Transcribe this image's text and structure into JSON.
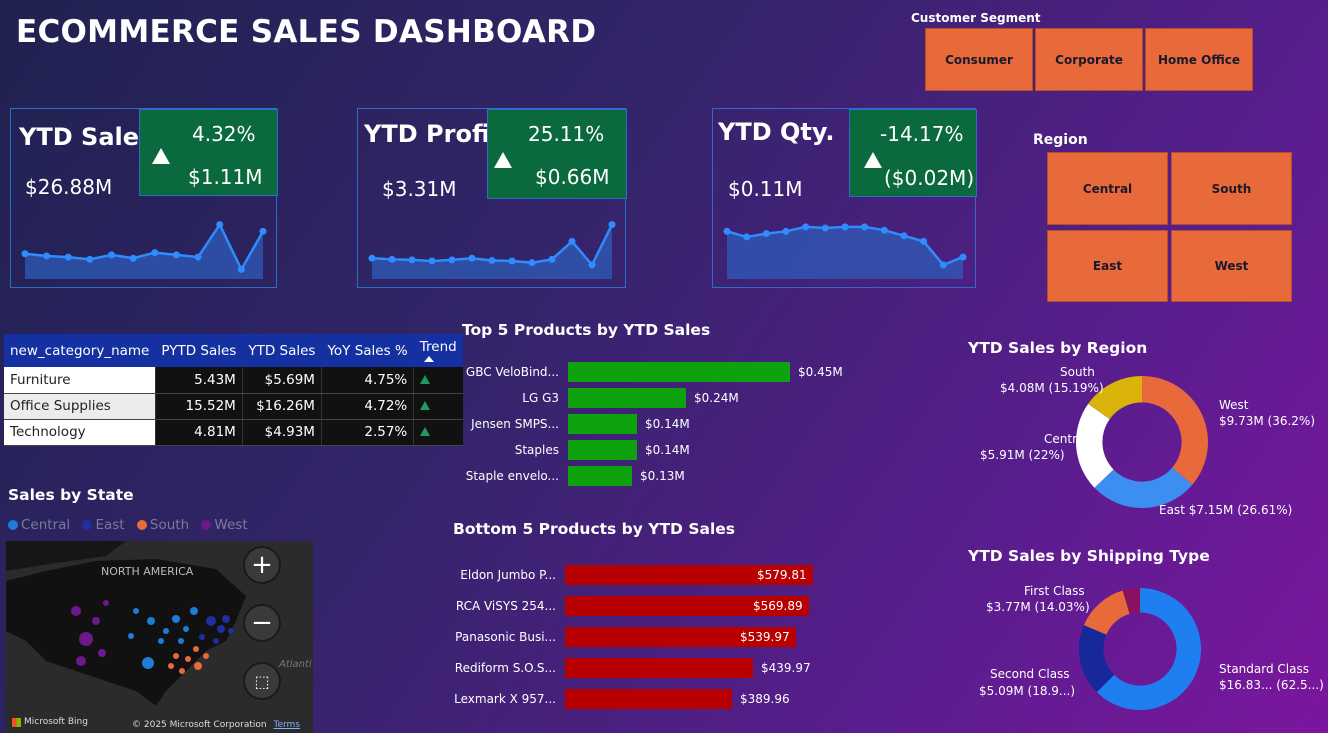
{
  "title": "ECOMMERCE SALES DASHBOARD",
  "customer_segment": {
    "label": "Customer Segment",
    "options": [
      "Consumer",
      "Corporate",
      "Home Office"
    ]
  },
  "region_slicer": {
    "label": "Region",
    "options": [
      "Central",
      "South",
      "East",
      "West"
    ]
  },
  "kpis": [
    {
      "title": "YTD Sales",
      "value": "$26.88M",
      "pct": "4.32%",
      "delta": "$1.11M",
      "trend": [
        0.38,
        0.34,
        0.32,
        0.28,
        0.36,
        0.3,
        0.4,
        0.36,
        0.32,
        0.9,
        0.1,
        0.78
      ]
    },
    {
      "title": "YTD Profit",
      "value": "$3.31M",
      "pct": "25.11%",
      "delta": "$0.66M",
      "trend": [
        0.3,
        0.28,
        0.27,
        0.25,
        0.27,
        0.3,
        0.26,
        0.25,
        0.22,
        0.28,
        0.6,
        0.18,
        0.9
      ]
    },
    {
      "title": "YTD Qty.",
      "value": "$0.11M",
      "pct": "-14.17%",
      "delta": "($0.02M)",
      "trend": [
        0.78,
        0.68,
        0.74,
        0.78,
        0.86,
        0.84,
        0.86,
        0.86,
        0.8,
        0.7,
        0.6,
        0.18,
        0.32
      ]
    }
  ],
  "category_table": {
    "headers": [
      "new_category_name",
      "PYTD Sales",
      "YTD Sales",
      "YoY Sales %",
      "Trend"
    ],
    "rows": [
      [
        "Furniture",
        "5.43M",
        "$5.69M",
        "4.75%"
      ],
      [
        "Office Supplies",
        "15.52M",
        "$16.26M",
        "4.72%"
      ],
      [
        "Technology",
        "4.81M",
        "$4.93M",
        "2.57%"
      ]
    ]
  },
  "sales_by_state": {
    "title": "Sales by State",
    "legend": [
      {
        "name": "Central",
        "color": "#1f7bd8"
      },
      {
        "name": "East",
        "color": "#1e2fa0"
      },
      {
        "name": "South",
        "color": "#e8693a"
      },
      {
        "name": "West",
        "color": "#6a1a8a"
      }
    ],
    "map_label": "NORTH AMERICA",
    "ocean_label": "Atlanti",
    "attribution": "© 2025 Microsoft Corporation",
    "terms": "Terms",
    "bing": "Microsoft Bing"
  },
  "top5": {
    "title": "Top 5 Products by YTD Sales",
    "color": "#0ea30e",
    "max": 0.45,
    "items": [
      {
        "label": "GBC VeloBind...",
        "value": 0.45,
        "text": "$0.45M"
      },
      {
        "label": "LG G3",
        "value": 0.24,
        "text": "$0.24M"
      },
      {
        "label": "Jensen SMPS...",
        "value": 0.14,
        "text": "$0.14M"
      },
      {
        "label": "Staples",
        "value": 0.14,
        "text": "$0.14M"
      },
      {
        "label": "Staple envelo...",
        "value": 0.13,
        "text": "$0.13M"
      }
    ]
  },
  "bottom5": {
    "title": "Bottom 5 Products by YTD Sales",
    "color": "#b80000",
    "max": 579.81,
    "items": [
      {
        "label": "Eldon Jumbo P...",
        "value": 579.81,
        "text": "$579.81"
      },
      {
        "label": "RCA ViSYS 254...",
        "value": 569.89,
        "text": "$569.89"
      },
      {
        "label": "Panasonic Busi...",
        "value": 539.97,
        "text": "$539.97"
      },
      {
        "label": "Rediform S.O.S...",
        "value": 439.97,
        "text": "$439.97"
      },
      {
        "label": "Lexmark X 957...",
        "value": 389.96,
        "text": "$389.96"
      }
    ]
  },
  "region_donut": {
    "title": "YTD Sales by Region",
    "slices": [
      {
        "name": "West",
        "value": 36.2,
        "color": "#e8693a",
        "label1": "West",
        "label2": "$9.73M (36.2%)"
      },
      {
        "name": "East",
        "value": 26.61,
        "color": "#3c8ef0",
        "label1": "East $7.15M (26.61%)",
        "label2": ""
      },
      {
        "name": "Central",
        "value": 22.0,
        "color": "#ffffff",
        "label1": "Central",
        "label2": "$5.91M (22%)"
      },
      {
        "name": "South",
        "value": 15.19,
        "color": "#d9b20a",
        "label1": "South",
        "label2": "$4.08M (15.19%)"
      }
    ]
  },
  "ship_donut": {
    "title": "YTD Sales by Shipping Type",
    "slices": [
      {
        "name": "Standard Class",
        "value": 62.5,
        "color": "#1f7ff0",
        "label1": "Standard Class",
        "label2": "$16.83... (62.5...)"
      },
      {
        "name": "Second Class",
        "value": 18.9,
        "color": "#17289a",
        "label1": "Second Class",
        "label2": "$5.09M (18.9...)"
      },
      {
        "name": "First Class",
        "value": 14.03,
        "color": "#e8693a",
        "label1": "First Class",
        "label2": "$3.77M (14.03%)"
      },
      {
        "name": "Same Day",
        "value": 4.57,
        "color": "#8a1060",
        "label1": "",
        "label2": ""
      }
    ]
  }
}
